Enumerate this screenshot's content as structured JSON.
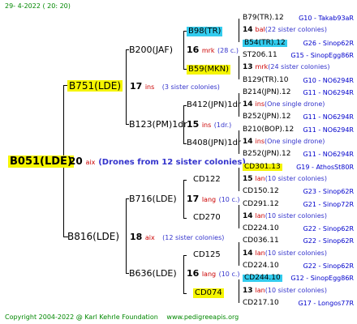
{
  "header": {
    "date": "29-  4-2022 ( 20: 20)"
  },
  "root": {
    "name": "B051(LDE)",
    "count": "20",
    "rel": "aix",
    "note": "(Drones from 12 sister colonies)"
  },
  "gen1": [
    {
      "name": "B751(LDE)",
      "count": "17",
      "rel": "ins",
      "note": "(3 sister colonies)"
    },
    {
      "name": "B816(LDE)",
      "count": "18",
      "rel": "aix",
      "note": "(12 sister colonies)"
    }
  ],
  "gen2": [
    {
      "name": "B200(JAF)",
      "count": "16",
      "rel": "mrk",
      "note": "(28 c.)"
    },
    {
      "name": "B123(PM)1dr",
      "count": "15",
      "rel": "ins",
      "note": "(1dr.)"
    },
    {
      "name": "B716(LDE)",
      "count": "17",
      "rel": "lang",
      "note": "(10 c.)"
    },
    {
      "name": "B636(LDE)",
      "count": "16",
      "rel": "lang",
      "note": "(10 c.)"
    }
  ],
  "gen3": [
    {
      "name": "B98(TR)"
    },
    {
      "name": "B59(MKN)"
    },
    {
      "name": "B412(JPN)1dr"
    },
    {
      "name": "B408(JPN)1dr"
    },
    {
      "name": "CD122"
    },
    {
      "name": "CD270"
    },
    {
      "name": "CD125"
    },
    {
      "name": "CD074"
    }
  ],
  "gen4": [
    {
      "name": "B79(TR).12",
      "ref": "G10 - Takab93aR"
    },
    {
      "count": "14",
      "rel": "bal",
      "note": "(22 sister colonies)"
    },
    {
      "name": "B54(TR).12",
      "ref": "G26 - Sinop62R"
    },
    {
      "name": "ST206.11",
      "ref": "G15 - SinopEgg86R"
    },
    {
      "count": "13",
      "rel": "mrk",
      "note": "(24 sister colonies)"
    },
    {
      "name": "B129(TR).10",
      "ref": "G10 - NO6294R"
    },
    {
      "name": "B214(JPN).12",
      "ref": "G11 - NO6294R"
    },
    {
      "count": "14",
      "rel": "ins",
      "note": "(One single drone)"
    },
    {
      "name": "B252(JPN).12",
      "ref": "G11 - NO6294R"
    },
    {
      "name": "B210(BOP).12",
      "ref": "G11 - NO6294R"
    },
    {
      "count": "14",
      "rel": "ins",
      "note": "(One single drone)"
    },
    {
      "name": "B252(JPN).12",
      "ref": "G11 - NO6294R"
    },
    {
      "name": "CD301.13",
      "ref": "G19 - AthosSt80R"
    },
    {
      "count": "15",
      "rel": "lan",
      "note": "(10 sister colonies)"
    },
    {
      "name": "CD150.12",
      "ref": "G23 - Sinop62R"
    },
    {
      "name": "CD291.12",
      "ref": "G21 - Sinop72R"
    },
    {
      "count": "14",
      "rel": "lan",
      "note": "(10 sister colonies)"
    },
    {
      "name": "CD224.10",
      "ref": "G22 - Sinop62R"
    },
    {
      "name": "CD036.11",
      "ref": "G22 - Sinop62R"
    },
    {
      "count": "14",
      "rel": "lan",
      "note": "(10 sister colonies)"
    },
    {
      "name": "CD224.10",
      "ref": "G22 - Sinop62R"
    },
    {
      "name": "CD244.10",
      "ref": "G12 - SinopEgg86R"
    },
    {
      "count": "13",
      "rel": "lan",
      "note": "(10 sister colonies)"
    },
    {
      "name": "CD217.10",
      "ref": "G17 - Longos77R"
    }
  ],
  "footer": {
    "copyright": "Copyright 2004-2022 @ Karl Kehrle Foundation",
    "site": "www.pedigreeapis.org"
  }
}
